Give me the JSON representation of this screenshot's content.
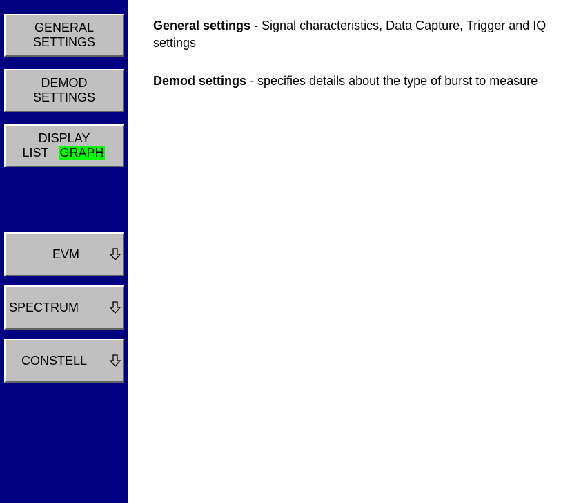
{
  "softkeys": {
    "general": {
      "line1": "GENERAL",
      "line2": "SETTINGS"
    },
    "demod": {
      "line1": "DEMOD",
      "line2": "SETTINGS"
    },
    "display": {
      "line1": "DISPLAY",
      "option_list": "LIST",
      "option_graph": "GRAPH",
      "selected": "GRAPH",
      "highlight_color": "#00ff00"
    },
    "evm": {
      "label": "EVM",
      "icon": "arrow-down-icon"
    },
    "spectrum": {
      "label": "SPECTRUM",
      "icon": "arrow-down-icon"
    },
    "constell": {
      "label": "CONSTELL",
      "icon": "arrow-down-icon"
    }
  },
  "colors": {
    "bar_background": "#000080",
    "key_face": "#c0c0c0"
  },
  "descriptions": {
    "general": {
      "term": "General settings",
      "text": " - Signal characteristics, Data Capture, Trigger and IQ settings"
    },
    "demod": {
      "term": "Demod settings",
      "text": " - specifies details about the type of burst to measure"
    }
  }
}
